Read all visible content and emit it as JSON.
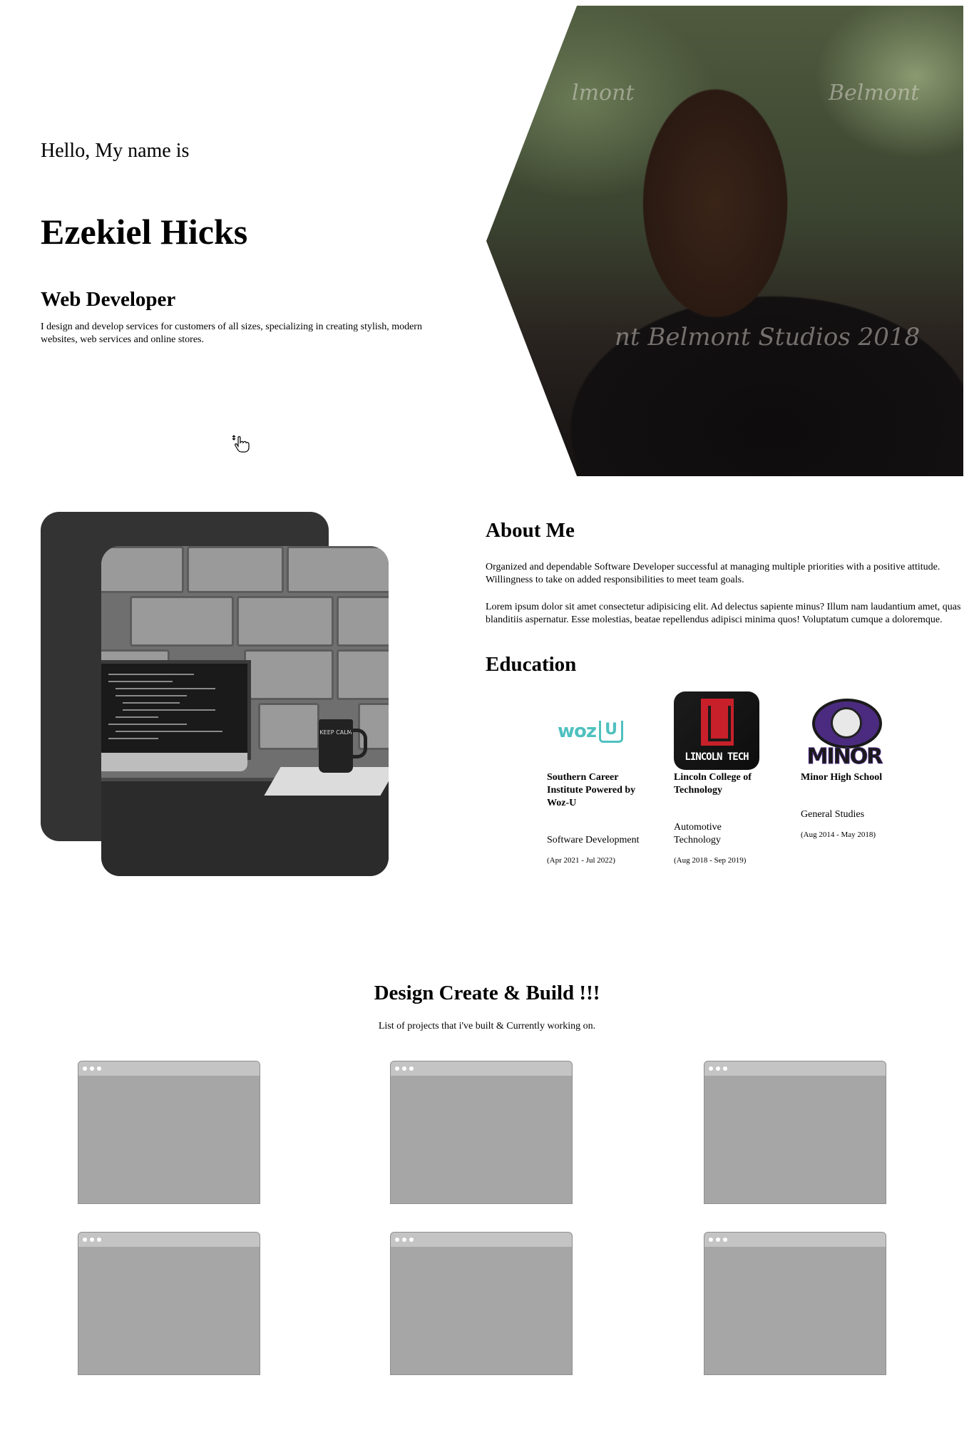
{
  "hero": {
    "greeting": "Hello, My name is",
    "name": "Ezekiel Hicks",
    "role": "Web Developer",
    "bio": "I design and develop services for customers of all sizes, specializing in creating stylish, modern websites, web services and online stores.",
    "photo_watermarks": [
      "lmont",
      "Belmont",
      "nt Belmont Studios 2018"
    ]
  },
  "about": {
    "title": "About Me",
    "paragraphs": [
      "Organized and dependable Software Developer successful at managing multiple priorities with a positive attitude. Willingness to take on added responsibilities to meet team goals.",
      "Lorem ipsum dolor sit amet consectetur adipisicing elit. Ad delectus sapiente minus? Illum nam laudantium amet, quas blanditiis aspernatur. Esse molestias, beatae repellendus adipisci minima quos! Voluptatum cumque a doloremque."
    ],
    "image_mug_text": "KEEP CALM"
  },
  "education": {
    "title": "Education",
    "schools": [
      {
        "logo_text": "woz",
        "logo_box": "U",
        "name": "Southern Career Institute Powered by Woz-U",
        "degree": "Software Development",
        "dates": "(Apr 2021 - Jul 2022)"
      },
      {
        "logo_text": "LINCOLN TECH",
        "name": "Lincoln College of Technology",
        "degree": "Automotive Technology",
        "dates": "(Aug 2018 - Sep 2019)"
      },
      {
        "logo_text": "MINOR",
        "name": "Minor High School",
        "degree": "General Studies",
        "dates": "(Aug 2014 - May 2018)"
      }
    ]
  },
  "projects": {
    "title": "Design Create & Build !!!",
    "subtitle": "List of projects that i've built & Currently working on."
  },
  "colors": {
    "card_body": "#a6a6a6",
    "card_bar": "#c4c4c4",
    "about_back": "#333333",
    "woz_teal": "#4fc1bf",
    "lincoln_red": "#c8202a",
    "minor_purple": "#4b2b7f"
  }
}
